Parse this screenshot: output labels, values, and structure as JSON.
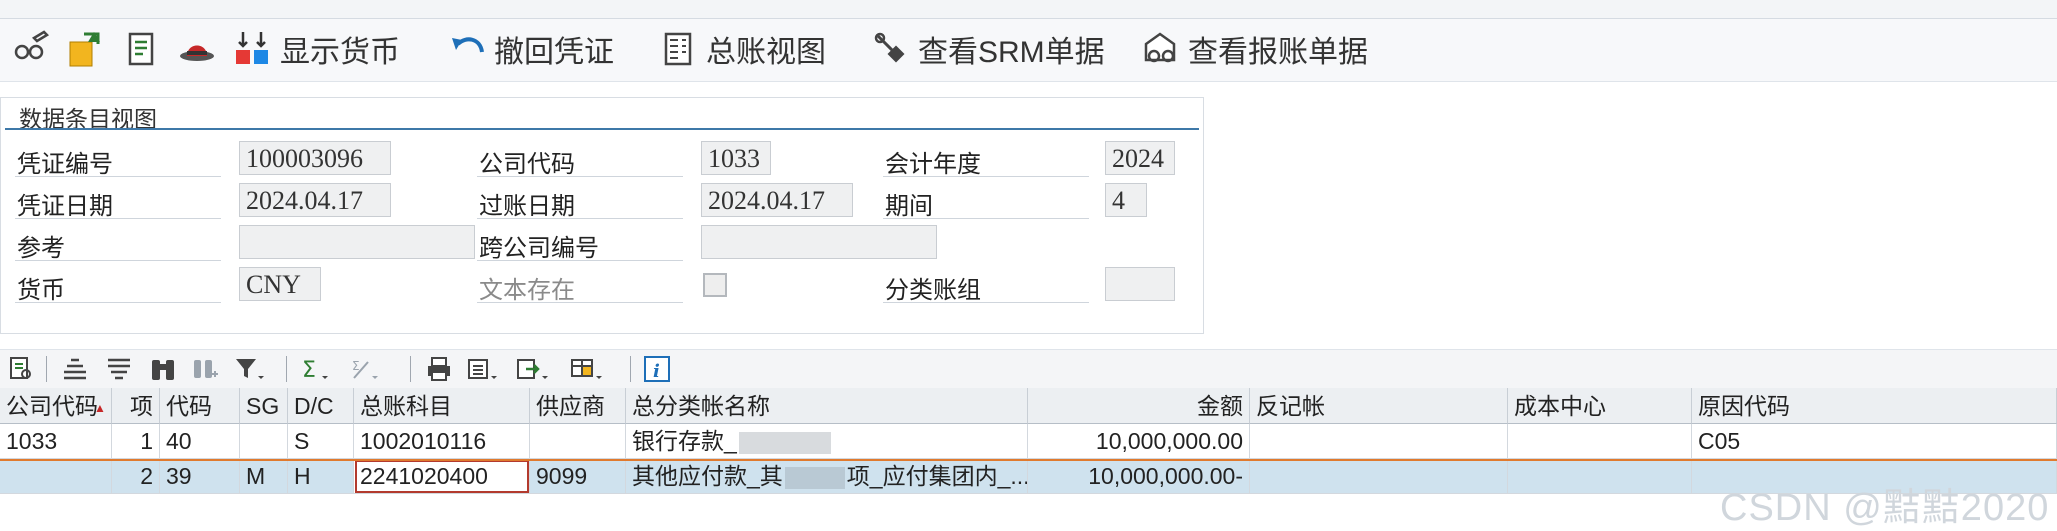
{
  "toolbar": {
    "display_currency": "显示货币",
    "reverse_document": "撤回凭证",
    "gl_view": "总账视图",
    "view_srm": "查看SRM单据",
    "view_expense": "查看报账单据"
  },
  "panel": {
    "title": "数据条目视图",
    "doc_no_label": "凭证编号",
    "doc_no": "100003096",
    "company_label": "公司代码",
    "company": "1033",
    "fiscal_year_label": "会计年度",
    "fiscal_year": "2024",
    "doc_date_label": "凭证日期",
    "doc_date": "2024.04.17",
    "posting_date_label": "过账日期",
    "posting_date": "2024.04.17",
    "period_label": "期间",
    "period": "4",
    "reference_label": "参考",
    "reference": "",
    "intercompany_label": "跨公司编号",
    "intercompany": "",
    "currency_label": "货币",
    "currency": "CNY",
    "text_exists_label": "文本存在",
    "ledger_group_label": "分类账组",
    "ledger_group": ""
  },
  "grid": {
    "headers": [
      "公司代码",
      "项",
      "代码",
      "SG",
      "D/C",
      "总账科目",
      "供应商",
      "总分类帐名称",
      "金额",
      "反记帐",
      "成本中心",
      "原因代码"
    ],
    "rows": [
      [
        "1033",
        "1",
        "40",
        "",
        "S",
        "1002010116",
        "",
        "银行存款_",
        "10,000,000.00",
        "",
        "",
        "C05"
      ],
      [
        "",
        "2",
        "39",
        "M",
        "H",
        "2241020400",
        "9099",
        "其他应付款_其",
        "10,000,000.00-",
        "",
        "",
        ""
      ]
    ],
    "row2_name_tail": "项_应付集团内_..."
  },
  "watermark": "CSDN @黠黠2020"
}
